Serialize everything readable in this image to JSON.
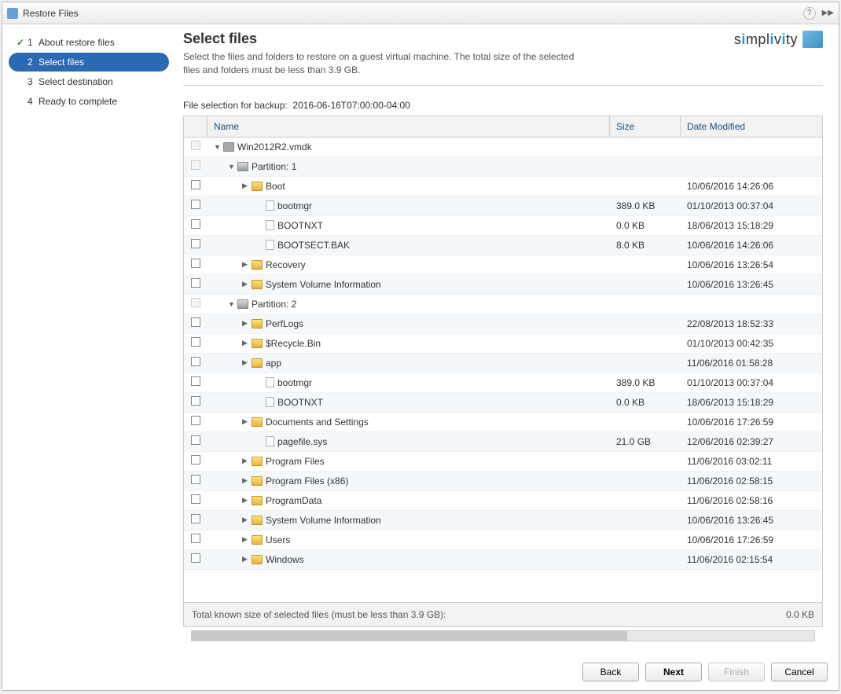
{
  "window": {
    "title": "Restore Files"
  },
  "sidebar": {
    "steps": [
      {
        "num": "1",
        "label": "About restore files",
        "state": "done"
      },
      {
        "num": "2",
        "label": "Select files",
        "state": "active"
      },
      {
        "num": "3",
        "label": "Select destination",
        "state": "future"
      },
      {
        "num": "4",
        "label": "Ready to complete",
        "state": "future"
      }
    ]
  },
  "main": {
    "title": "Select files",
    "description": "Select the files and folders to restore on a guest virtual machine. The total size of the selected files and folders must be less than 3.9 GB.",
    "brand": "simplivity",
    "backup_label": "File selection for backup:",
    "backup_ts": "2016-06-16T07:00:00-04:00",
    "headers": {
      "name": "Name",
      "size": "Size",
      "date": "Date Modified"
    },
    "rows": [
      {
        "indent": 0,
        "chk": "disabled",
        "arrow": "down",
        "icon": "disk",
        "name": "Win2012R2.vmdk",
        "size": "",
        "date": ""
      },
      {
        "indent": 1,
        "chk": "disabled",
        "arrow": "down",
        "icon": "part",
        "name": "Partition: 1",
        "size": "",
        "date": ""
      },
      {
        "indent": 2,
        "chk": "normal",
        "arrow": "right",
        "icon": "folder",
        "name": "Boot",
        "size": "",
        "date": "10/06/2016 14:26:06"
      },
      {
        "indent": 3,
        "chk": "normal",
        "arrow": "",
        "icon": "file",
        "name": "bootmgr",
        "size": "389.0 KB",
        "date": "01/10/2013 00:37:04"
      },
      {
        "indent": 3,
        "chk": "normal",
        "arrow": "",
        "icon": "file",
        "name": "BOOTNXT",
        "size": "0.0 KB",
        "date": "18/06/2013 15:18:29"
      },
      {
        "indent": 3,
        "chk": "normal",
        "arrow": "",
        "icon": "file",
        "name": "BOOTSECT.BAK",
        "size": "8.0 KB",
        "date": "10/06/2016 14:26:06"
      },
      {
        "indent": 2,
        "chk": "normal",
        "arrow": "right",
        "icon": "folder",
        "name": "Recovery",
        "size": "",
        "date": "10/06/2016 13:26:54"
      },
      {
        "indent": 2,
        "chk": "normal",
        "arrow": "right",
        "icon": "folder",
        "name": "System Volume Information",
        "size": "",
        "date": "10/06/2016 13:26:45"
      },
      {
        "indent": 1,
        "chk": "disabled",
        "arrow": "down",
        "icon": "part",
        "name": "Partition: 2",
        "size": "",
        "date": ""
      },
      {
        "indent": 2,
        "chk": "normal",
        "arrow": "right",
        "icon": "folder",
        "name": "PerfLogs",
        "size": "",
        "date": "22/08/2013 18:52:33"
      },
      {
        "indent": 2,
        "chk": "normal",
        "arrow": "right",
        "icon": "folder",
        "name": "$Recycle.Bin",
        "size": "",
        "date": "01/10/2013 00:42:35"
      },
      {
        "indent": 2,
        "chk": "normal",
        "arrow": "right",
        "icon": "folder",
        "name": "app",
        "size": "",
        "date": "11/06/2016 01:58:28"
      },
      {
        "indent": 3,
        "chk": "normal",
        "arrow": "",
        "icon": "file",
        "name": "bootmgr",
        "size": "389.0 KB",
        "date": "01/10/2013 00:37:04"
      },
      {
        "indent": 3,
        "chk": "normal",
        "arrow": "",
        "icon": "file",
        "name": "BOOTNXT",
        "size": "0.0 KB",
        "date": "18/06/2013 15:18:29"
      },
      {
        "indent": 2,
        "chk": "normal",
        "arrow": "right",
        "icon": "folder",
        "name": "Documents and Settings",
        "size": "",
        "date": "10/06/2016 17:26:59"
      },
      {
        "indent": 3,
        "chk": "normal",
        "arrow": "",
        "icon": "file",
        "name": "pagefile.sys",
        "size": "21.0 GB",
        "date": "12/06/2016 02:39:27"
      },
      {
        "indent": 2,
        "chk": "normal",
        "arrow": "right",
        "icon": "folder",
        "name": "Program Files",
        "size": "",
        "date": "11/06/2016 03:02:11"
      },
      {
        "indent": 2,
        "chk": "normal",
        "arrow": "right",
        "icon": "folder",
        "name": "Program Files (x86)",
        "size": "",
        "date": "11/06/2016 02:58:15"
      },
      {
        "indent": 2,
        "chk": "normal",
        "arrow": "right",
        "icon": "folder",
        "name": "ProgramData",
        "size": "",
        "date": "11/06/2016 02:58:16"
      },
      {
        "indent": 2,
        "chk": "normal",
        "arrow": "right",
        "icon": "folder",
        "name": "System Volume Information",
        "size": "",
        "date": "10/06/2016 13:26:45"
      },
      {
        "indent": 2,
        "chk": "normal",
        "arrow": "right",
        "icon": "folder",
        "name": "Users",
        "size": "",
        "date": "10/06/2016 17:26:59"
      },
      {
        "indent": 2,
        "chk": "normal",
        "arrow": "right",
        "icon": "folder",
        "name": "Windows",
        "size": "",
        "date": "11/06/2016 02:15:54"
      }
    ],
    "footer_label": "Total known size of selected files (must be less than 3.9 GB):",
    "footer_value": "0.0 KB"
  },
  "buttons": {
    "back": "Back",
    "next": "Next",
    "finish": "Finish",
    "cancel": "Cancel"
  }
}
